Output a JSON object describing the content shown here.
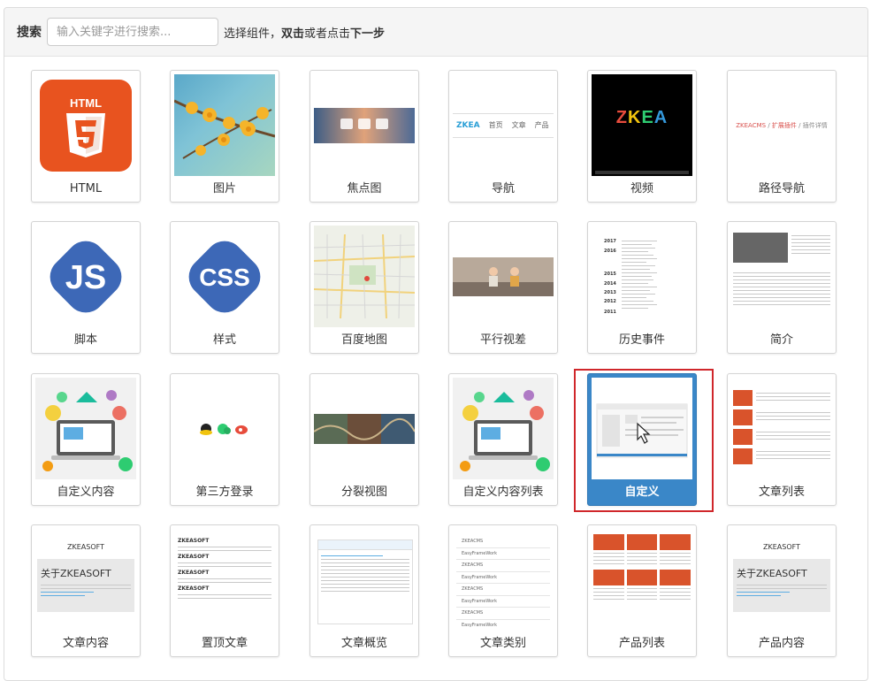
{
  "search": {
    "label": "搜索",
    "placeholder": "输入关键字进行搜索..."
  },
  "hint": {
    "pre": "选择组件，",
    "bold1": "双击",
    "mid": "或者点击",
    "bold2": "下一步"
  },
  "widgets": [
    {
      "label": "HTML",
      "icon": "html5-icon"
    },
    {
      "label": "图片",
      "icon": "image-icon"
    },
    {
      "label": "焦点图",
      "icon": "carousel-icon"
    },
    {
      "label": "导航",
      "icon": "navigation-icon"
    },
    {
      "label": "视频",
      "icon": "video-icon"
    },
    {
      "label": "路径导航",
      "icon": "breadcrumb-icon"
    },
    {
      "label": "脚本",
      "icon": "js-icon"
    },
    {
      "label": "样式",
      "icon": "css-icon"
    },
    {
      "label": "百度地图",
      "icon": "map-icon"
    },
    {
      "label": "平行视差",
      "icon": "parallax-icon"
    },
    {
      "label": "历史事件",
      "icon": "timeline-icon"
    },
    {
      "label": "简介",
      "icon": "intro-icon"
    },
    {
      "label": "自定义内容",
      "icon": "custom-content-icon"
    },
    {
      "label": "第三方登录",
      "icon": "social-login-icon"
    },
    {
      "label": "分裂视图",
      "icon": "split-view-icon"
    },
    {
      "label": "自定义内容列表",
      "icon": "custom-content-list-icon"
    },
    {
      "label": "自定义",
      "icon": "custom-icon"
    },
    {
      "label": "文章列表",
      "icon": "article-list-icon"
    },
    {
      "label": "文章内容",
      "icon": "article-content-icon"
    },
    {
      "label": "置顶文章",
      "icon": "top-article-icon"
    },
    {
      "label": "文章概览",
      "icon": "article-summary-icon"
    },
    {
      "label": "文章类别",
      "icon": "article-category-icon"
    },
    {
      "label": "产品列表",
      "icon": "product-list-icon"
    },
    {
      "label": "产品内容",
      "icon": "product-content-icon"
    }
  ],
  "selected_widget": "自定义",
  "thumbs": {
    "html_badge": "HTML",
    "zkea_logo": "ZKEA",
    "nav_items": [
      "首页",
      "文章",
      "产品"
    ],
    "breadcrumb": [
      "ZKEACMS",
      "扩展插件",
      "插件详情"
    ],
    "js_text": "JS",
    "css_text": "CSS",
    "years": [
      "2017",
      "2016",
      "2015",
      "2014",
      "2013",
      "2012",
      "2011"
    ],
    "zkeasoft": "ZKEASOFT",
    "about": "关于ZKEASOFT",
    "categories": [
      "ZKEACMS",
      "EasyFrameWork",
      "ZKEACMS",
      "EasyFrameWork",
      "ZKEACMS",
      "EasyFrameWork",
      "ZKEACMS",
      "EasyFrameWork"
    ]
  },
  "colors": {
    "selected_bg": "#3a87c8",
    "selected_outline": "#d0272b",
    "html5_orange": "#e8531f",
    "badge_blue": "#3d68b7"
  }
}
